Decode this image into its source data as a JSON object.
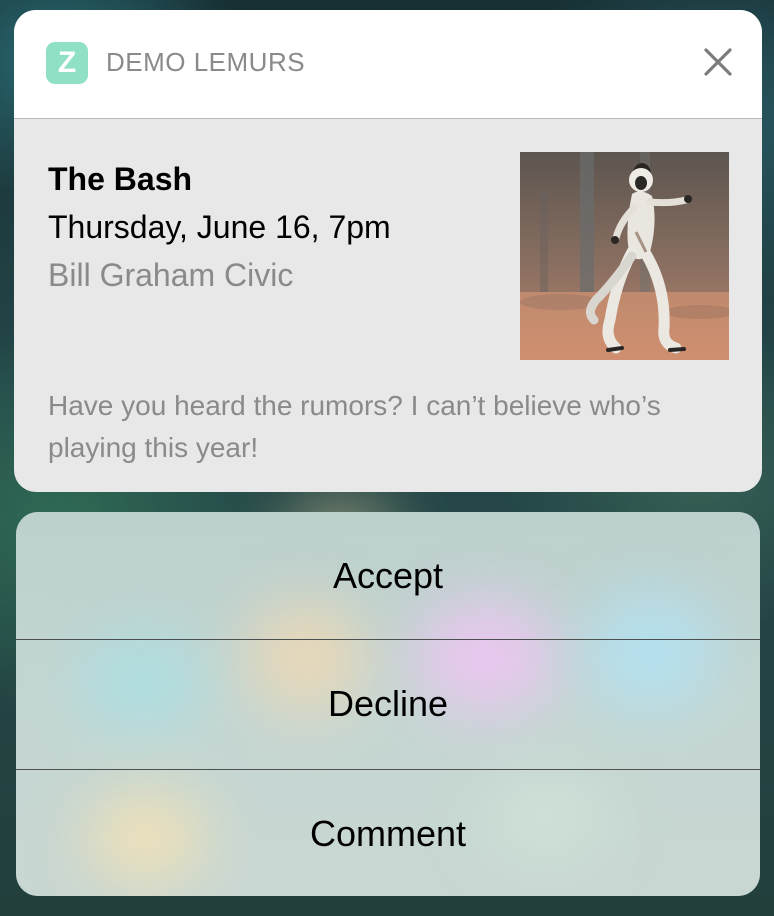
{
  "notification": {
    "app_icon_letter": "Z",
    "app_name": "DEMO LEMURS",
    "title": "The Bash",
    "date": "Thursday, June 16, 7pm",
    "venue": "Bill Graham Civic",
    "message": "Have you heard the rumors? I can’t believe who’s playing this year!",
    "image": "lemur-photo"
  },
  "actions": [
    {
      "label": "Accept"
    },
    {
      "label": "Decline"
    },
    {
      "label": "Comment"
    }
  ],
  "colors": {
    "app_icon": "#8fe0c4",
    "secondary_text": "#8a8a8a",
    "card_body": "#e8e8e8",
    "card_header": "#ffffff"
  }
}
